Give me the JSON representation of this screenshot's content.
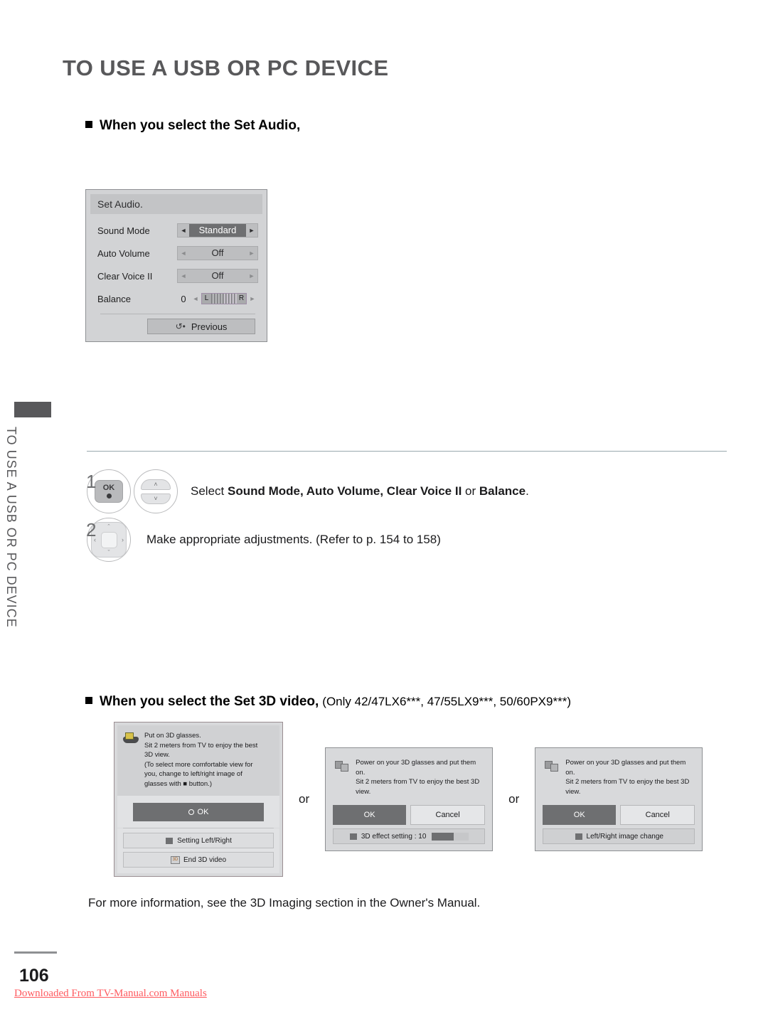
{
  "header": {
    "title": "TO USE A USB OR PC DEVICE"
  },
  "sidebar": {
    "tab_label": "TO USE A USB OR PC DEVICE"
  },
  "sections": {
    "audio": {
      "title": "When you select the Set Audio,"
    },
    "three_d": {
      "title": "When you select the Set 3D video,",
      "models": "(Only 42/47LX6***, 47/55LX9***, 50/60PX9***)"
    }
  },
  "set_audio_osd": {
    "window_title": "Set Audio.",
    "rows": [
      {
        "label": "Sound Mode",
        "value": "Standard",
        "selected": true
      },
      {
        "label": "Auto Volume",
        "value": "Off",
        "selected": false
      },
      {
        "label": "Clear Voice II",
        "value": "Off",
        "selected": false
      }
    ],
    "balance": {
      "label": "Balance",
      "value": "0",
      "left_marker": "L",
      "right_marker": "R"
    },
    "previous_button": "Previous",
    "arrow_left": "◄",
    "arrow_right": "►"
  },
  "steps": [
    {
      "number": "1",
      "ok_label": "OK",
      "up_glyph": "˄",
      "down_glyph": "˅",
      "text_pre": "Select ",
      "text_bold1": "Sound Mode, Auto Volume, Clear Voice II",
      "text_mid": " or ",
      "text_bold2": "Balance",
      "text_post": "."
    },
    {
      "number": "2",
      "text": "Make appropriate adjustments. (Refer to p. 154 to 158)"
    }
  ],
  "three_d_dialogs": {
    "separator": "or",
    "dialog_1": {
      "message_lines": [
        "Put on 3D glasses.",
        "Sit 2 meters from TV to enjoy the best",
        "3D view.",
        "(To select more comfortable view for",
        "you, change to left/right image of",
        "glasses with ■ button.)"
      ],
      "ok_button": "OK",
      "item_setting": "Setting Left/Right",
      "item_end": "End 3D video",
      "end_icon_label": "3D"
    },
    "dialog_2": {
      "message_lines": [
        "Power on your 3D glasses and put them on.",
        "Sit 2 meters from TV to enjoy the best 3D",
        "view."
      ],
      "ok_button": "OK",
      "cancel_button": "Cancel",
      "bottom_bar": "3D effect setting : 10"
    },
    "dialog_3": {
      "message_lines": [
        "Power on your 3D glasses and put them on.",
        "Sit 2 meters from TV to enjoy the best 3D",
        "view."
      ],
      "ok_button": "OK",
      "cancel_button": "Cancel",
      "bottom_bar": "Left/Right image change"
    }
  },
  "footer": {
    "note": "For more information, see the 3D Imaging section in the Owner's Manual.",
    "page_number": "106",
    "download_note": "Downloaded From TV-Manual.com Manuals"
  },
  "colors": {
    "title_gray": "#58585a",
    "osd_bg": "#d2d3d5",
    "osd_selected": "#6e6f71",
    "accent_red": "#ff5a5f"
  }
}
